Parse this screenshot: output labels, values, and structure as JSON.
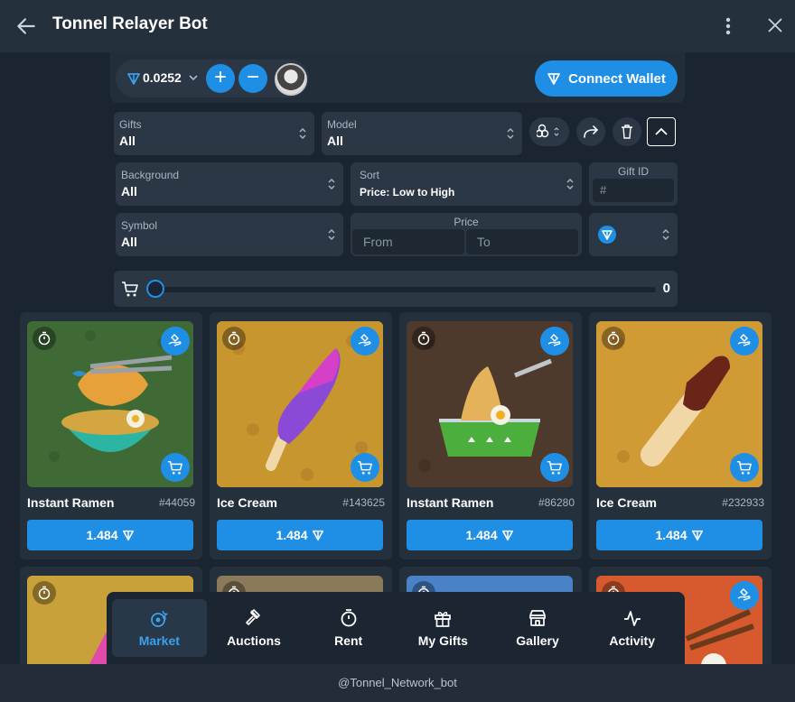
{
  "window": {
    "title": "Tonnel Relayer Bot",
    "footer": "@Tonnel_Network_bot"
  },
  "wallet": {
    "balance": "0.0252",
    "connect_label": "Connect Wallet"
  },
  "filters": {
    "gifts": {
      "label": "Gifts",
      "value": "All"
    },
    "model": {
      "label": "Model",
      "value": "All"
    },
    "background": {
      "label": "Background",
      "value": "All"
    },
    "sort": {
      "label": "Sort",
      "value": "Price: Low to High"
    },
    "gift_id": {
      "label": "Gift ID",
      "placeholder": "#"
    },
    "symbol": {
      "label": "Symbol",
      "value": "All"
    },
    "price": {
      "label": "Price",
      "from_placeholder": "From",
      "to_placeholder": "To"
    }
  },
  "cart": {
    "count": "0"
  },
  "gifts": [
    {
      "name": "Instant Ramen",
      "number": "#44059",
      "price": "1.484",
      "bg": "#3f6a36"
    },
    {
      "name": "Ice Cream",
      "number": "#143625",
      "price": "1.484",
      "bg": "#c8962e"
    },
    {
      "name": "Instant Ramen",
      "number": "#86280",
      "price": "1.484",
      "bg": "#4e3a2c"
    },
    {
      "name": "Ice Cream",
      "number": "#232933",
      "price": "1.484",
      "bg": "#d09a34"
    }
  ],
  "nav": [
    {
      "label": "Market",
      "icon": "market-icon",
      "active": true
    },
    {
      "label": "Auctions",
      "icon": "gavel-icon"
    },
    {
      "label": "Rent",
      "icon": "stopwatch-icon"
    },
    {
      "label": "My Gifts",
      "icon": "gift-icon"
    },
    {
      "label": "Gallery",
      "icon": "store-icon"
    },
    {
      "label": "Activity",
      "icon": "activity-icon"
    }
  ],
  "colors": {
    "accent": "#1f8fe5",
    "bg": "#1b2531",
    "panel": "#2b3745"
  }
}
